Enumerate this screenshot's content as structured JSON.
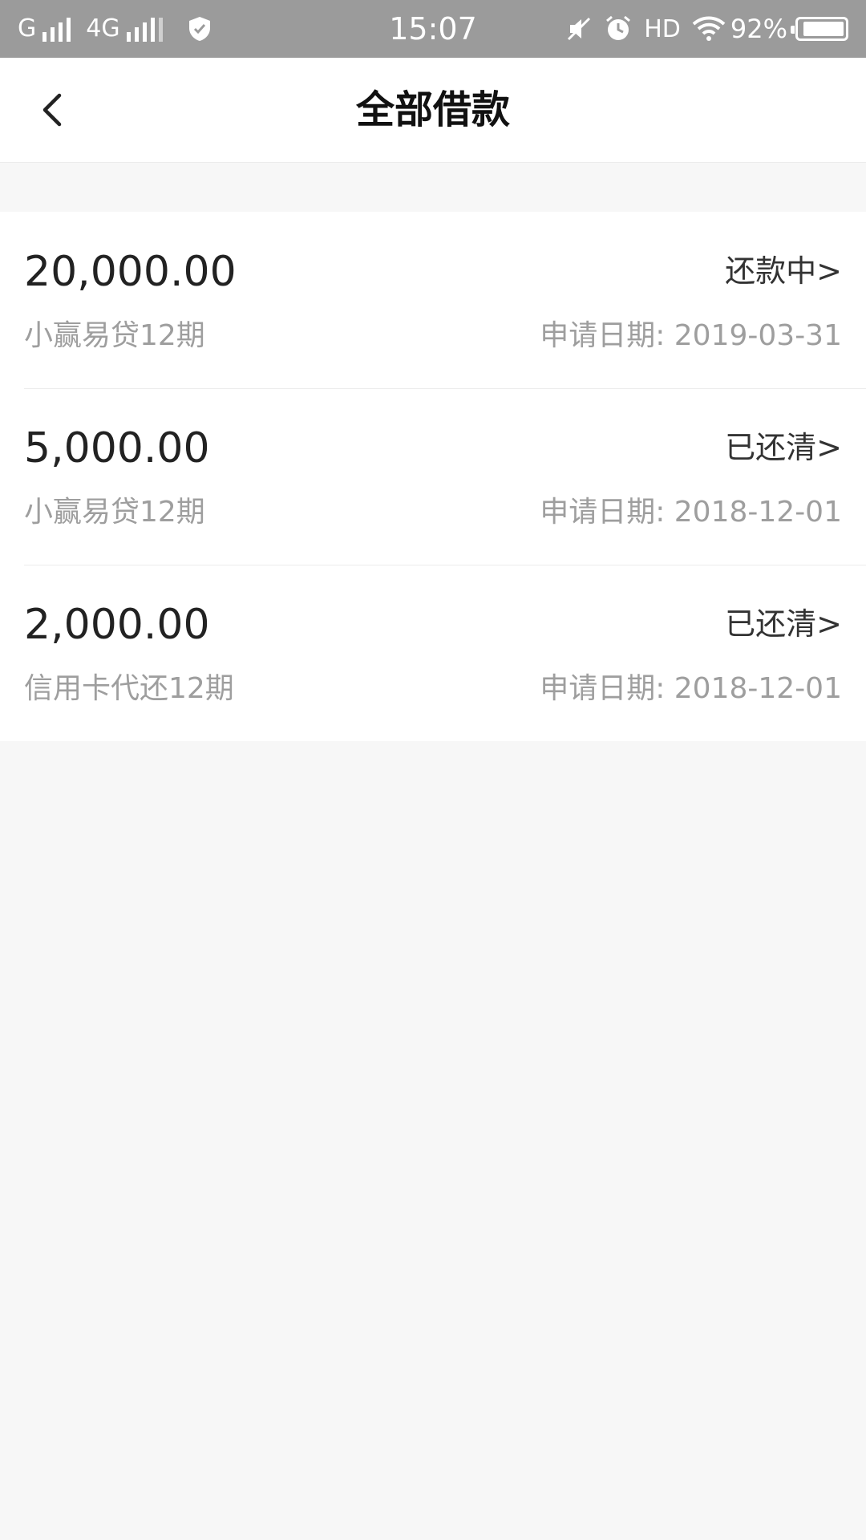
{
  "status_bar": {
    "carrier1": "G",
    "carrier2": "4G",
    "time": "15:07",
    "hd": "HD",
    "battery_percent": "92%",
    "battery_level": 0.92,
    "icons": [
      "signal-icon",
      "shield-check-icon",
      "mute-icon",
      "alarm-icon",
      "wifi-icon",
      "battery-icon"
    ]
  },
  "header": {
    "title": "全部借款",
    "back_icon": "chevron-left-icon"
  },
  "loans": [
    {
      "amount": "20,000.00",
      "status": "还款中>",
      "product": "小赢易贷12期",
      "date": "申请日期: 2019-03-31"
    },
    {
      "amount": "5,000.00",
      "status": "已还清>",
      "product": "小赢易贷12期",
      "date": "申请日期: 2018-12-01"
    },
    {
      "amount": "2,000.00",
      "status": "已还清>",
      "product": "信用卡代还12期",
      "date": "申请日期: 2018-12-01"
    }
  ]
}
